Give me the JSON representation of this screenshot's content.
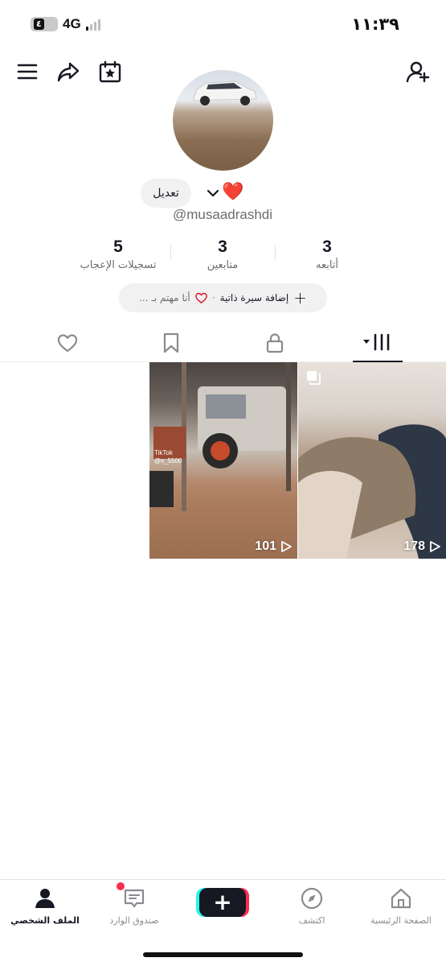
{
  "status_bar": {
    "battery": "٤",
    "network": "4G",
    "time": "١١:٣٩"
  },
  "profile": {
    "edit_label": "تعديل",
    "name_emoji": "❤️",
    "username": "@musaadrashdi"
  },
  "stats": [
    {
      "value": "5",
      "label": "تسجيلات الإعجاب"
    },
    {
      "value": "3",
      "label": "متابعين"
    },
    {
      "value": "3",
      "label": "أتابعه"
    }
  ],
  "bio": {
    "add_label": "إضافة سيرة ذاتية",
    "separator": "·",
    "interest_label": "أنا مهتم بـ ..."
  },
  "videos": [
    {
      "views": "178",
      "watermark": ""
    },
    {
      "views": "101",
      "watermark": "TikTok\n@x_5500"
    }
  ],
  "bottom_nav": {
    "home": "الصفحة الرئيسية",
    "discover": "اكتشف",
    "create": "+",
    "inbox": "صندوق الوارد",
    "profile": "الملف الشخصي"
  },
  "colors": {
    "accent_red": "#fe2c55",
    "accent_cyan": "#25f4ee",
    "text_primary": "#161823",
    "text_secondary": "#6c6c70"
  }
}
